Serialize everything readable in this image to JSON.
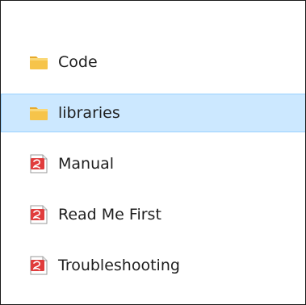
{
  "items": [
    {
      "label": "Code",
      "icon": "folder-icon",
      "selected": false
    },
    {
      "label": "libraries",
      "icon": "folder-icon",
      "selected": true
    },
    {
      "label": "Manual",
      "icon": "pdf-file-icon",
      "selected": false
    },
    {
      "label": "Read Me First",
      "icon": "pdf-file-icon",
      "selected": false
    },
    {
      "label": "Troubleshooting",
      "icon": "pdf-file-icon",
      "selected": false
    }
  ],
  "colors": {
    "selection_background": "#cce8ff",
    "selection_border": "#99d1ff",
    "folder": "#f6c44a",
    "pdf": "#e03c3c"
  }
}
